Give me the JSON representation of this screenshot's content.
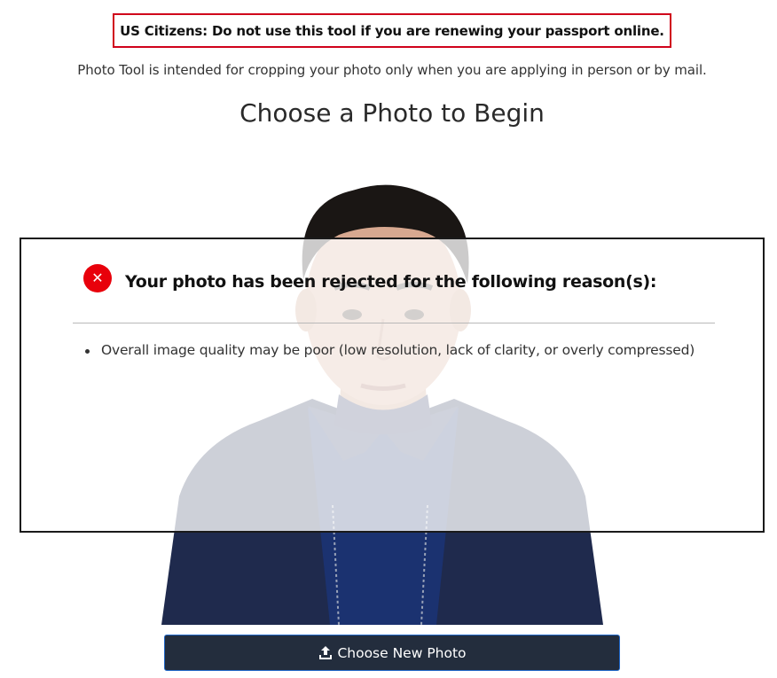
{
  "warning": {
    "text": "US Citizens: Do not use this tool if you are renewing your passport online."
  },
  "intro": {
    "text": "Photo Tool is intended for cropping your photo only when you are applying in person or by mail."
  },
  "title": {
    "text": "Choose a Photo to Begin"
  },
  "photo": {
    "icon": "portrait-photo"
  },
  "rejection": {
    "icon": "error-x-icon",
    "icon_glyph": "✕",
    "title": "Your photo has been rejected for the following reason(s):",
    "reasons": [
      "Overall image quality may be poor (low resolution, lack of clarity, or overly compressed)"
    ]
  },
  "actions": {
    "choose_new_label": "Choose New Photo",
    "choose_new_icon": "upload-icon"
  },
  "colors": {
    "warning_border": "#d0021b",
    "error_icon": "#e8000b",
    "button_bg": "#232d3d",
    "button_border": "#1f66c6"
  }
}
